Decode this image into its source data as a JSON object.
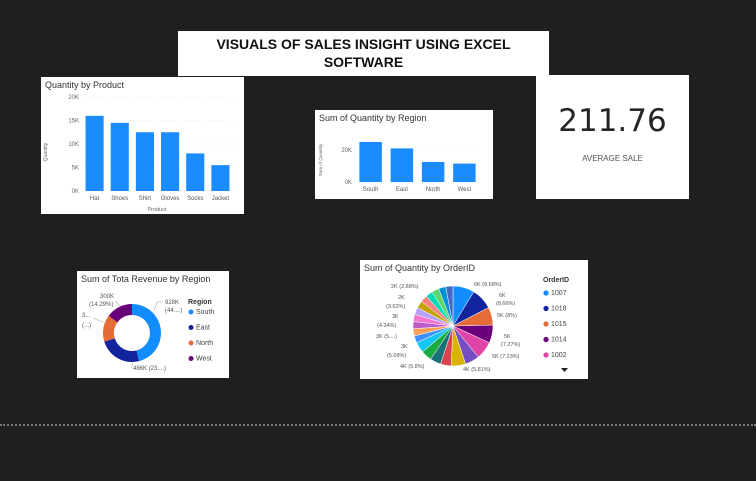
{
  "header": {
    "line1": "VISUALS OF SALES INSIGHT USING EXCEL",
    "line2": "SOFTWARE"
  },
  "kpi": {
    "value": "211.76",
    "label": "AVERAGE SALE"
  },
  "chart_data": [
    {
      "id": "qty_by_product",
      "type": "bar",
      "title": "Quantity by Product",
      "xlabel": "Product",
      "ylabel": "Quantity",
      "categories": [
        "Hat",
        "Shoes",
        "Shirt",
        "Gloves",
        "Socks",
        "Jacket"
      ],
      "values": [
        16000,
        14500,
        12500,
        12500,
        8000,
        5500
      ],
      "ylim": [
        0,
        20000
      ],
      "yticks": [
        "0K",
        "5K",
        "10K",
        "15K",
        "20K"
      ],
      "grid": true,
      "color": "#1a8cff"
    },
    {
      "id": "qty_by_region",
      "type": "bar",
      "title": "Sum of Quantity by Region",
      "ylabel": "Sum of Quantity",
      "categories": [
        "South",
        "East",
        "North",
        "West"
      ],
      "values": [
        25000,
        21000,
        12500,
        11500
      ],
      "ylim": [
        0,
        30000
      ],
      "yticks": [
        "0K",
        "20K"
      ],
      "grid": true,
      "color": "#1a8cff"
    },
    {
      "id": "revenue_by_region",
      "type": "pie",
      "donut": true,
      "title": "Sum of Tota Revenue by Region",
      "legend_title": "Region",
      "legend_placement": "right",
      "categories": [
        "South",
        "East",
        "North",
        "West"
      ],
      "values": [
        928000,
        486000,
        300000,
        300000
      ],
      "colors": [
        "#118dff",
        "#12239e",
        "#e66c37",
        "#6b007b"
      ],
      "labels": [
        "928K",
        "(44....)",
        "486K (23....)",
        "300K",
        "(14.29%)",
        "3...",
        "(...)"
      ]
    },
    {
      "id": "qty_by_orderid",
      "type": "pie",
      "title": "Sum of Quantity by OrderID",
      "legend_title": "OrderID",
      "legend_placement": "right",
      "legend_items": [
        "1007",
        "1018",
        "1015",
        "1014",
        "1002"
      ],
      "legend_colors": [
        "#118dff",
        "#12239e",
        "#e66c37",
        "#6b007b",
        "#e044a7"
      ],
      "values": [
        6,
        6,
        5,
        5,
        5,
        4,
        4,
        3,
        3,
        3,
        3,
        2,
        2,
        2,
        2,
        2,
        2,
        2,
        2,
        2,
        2,
        2
      ],
      "colors": [
        "#118dff",
        "#12239e",
        "#e66c37",
        "#6b007b",
        "#e044a7",
        "#744ec2",
        "#d9b300",
        "#d64550",
        "#197278",
        "#1aab40",
        "#15c6f4",
        "#4092ff",
        "#ffa058",
        "#be5dc9",
        "#f472d0",
        "#b5a1ff",
        "#c4a200",
        "#ff8080",
        "#00dbbc",
        "#5bd667",
        "#0091d5",
        "#4668c5"
      ],
      "labels": [
        "6K (8.68%)",
        "6K",
        "(8.66%)",
        "5K (8%)",
        "5K",
        "(7.27%)",
        "5K (7.23%)",
        "4K (5.81%)",
        "4K (5.8%)",
        "3K",
        "(5.09%)",
        "3K (5....)",
        "3K",
        "(4.34%)",
        "2K",
        "(3.62%)",
        "2K (2.88%)"
      ]
    }
  ]
}
